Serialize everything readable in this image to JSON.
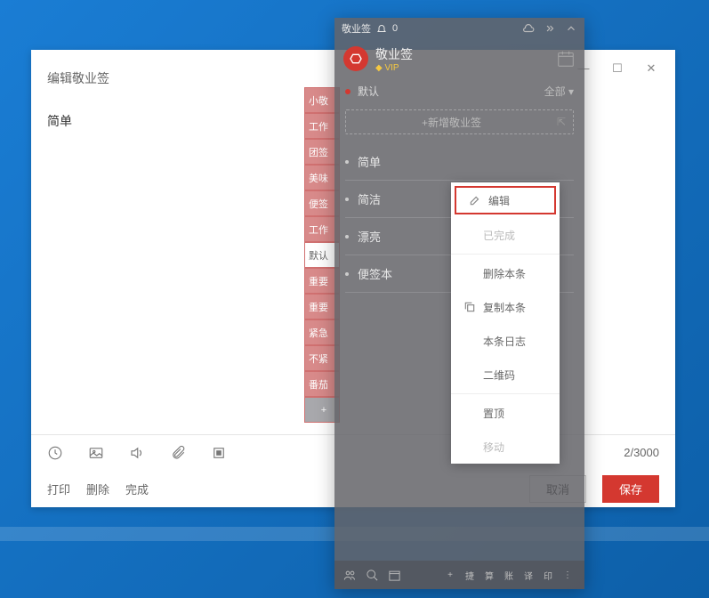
{
  "editor": {
    "title": "编辑敬业签",
    "content": "简单",
    "char_count": "2/3000",
    "footer": {
      "print": "打印",
      "delete": "删除",
      "complete": "完成",
      "cancel": "取消",
      "save": "保存"
    }
  },
  "app": {
    "titlebar_name": "敬业签",
    "bell_count": "0",
    "name": "敬业签",
    "vip": "VIP",
    "category": "默认",
    "filter": "全部",
    "add_placeholder": "新增敬业签",
    "notes": [
      "简单",
      "简洁",
      "漂亮",
      "便签本"
    ],
    "bottom_chips": [
      "捷",
      "算",
      "账",
      "译",
      "印"
    ]
  },
  "side_tabs": [
    "小敬",
    "工作",
    "团签",
    "美味",
    "便签",
    "工作",
    "默认",
    "重要",
    "重要",
    "紧急",
    "不紧",
    "番茄"
  ],
  "side_tabs_active_index": 6,
  "context_menu": {
    "edit": "编辑",
    "complete": "已完成",
    "delete": "删除本条",
    "copy": "复制本条",
    "log": "本条日志",
    "qrcode": "二维码",
    "pin": "置顶",
    "move": "移动"
  }
}
